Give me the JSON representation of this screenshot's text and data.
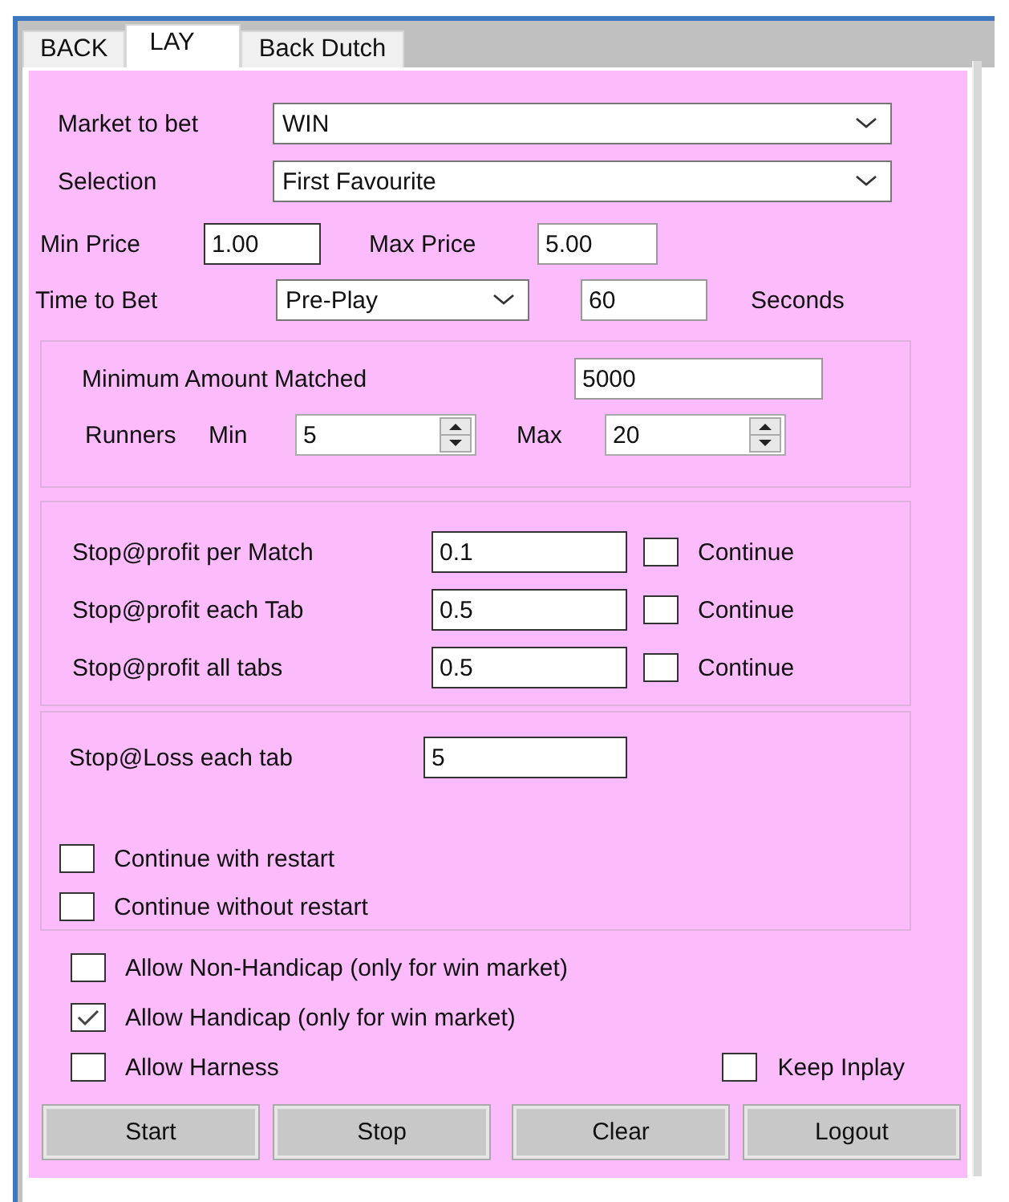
{
  "tabs": [
    {
      "label": "BACK",
      "selected": false
    },
    {
      "label": "LAY",
      "selected": true
    },
    {
      "label": "Back Dutch",
      "selected": false
    }
  ],
  "market": {
    "label": "Market to bet",
    "value": "WIN"
  },
  "selection": {
    "label": "Selection",
    "value": "First Favourite"
  },
  "min_price": {
    "label": "Min Price",
    "value": "1.00"
  },
  "max_price": {
    "label": "Max Price",
    "value": "5.00"
  },
  "time_to_bet": {
    "label": "Time to Bet",
    "value": "Pre-Play",
    "seconds_value": "60",
    "seconds_label": "Seconds"
  },
  "minimum_amount_matched": {
    "label": "Minimum Amount Matched",
    "value": "5000"
  },
  "runners": {
    "label": "Runners",
    "min_label": "Min",
    "min_value": "5",
    "max_label": "Max",
    "max_value": "20"
  },
  "stop_profit": [
    {
      "label": "Stop@profit per Match",
      "value": "0.1",
      "checkbox_label": "Continue",
      "checked": false
    },
    {
      "label": "Stop@profit each Tab",
      "value": "0.5",
      "checkbox_label": "Continue",
      "checked": false
    },
    {
      "label": "Stop@profit all tabs",
      "value": "0.5",
      "checkbox_label": "Continue",
      "checked": false
    }
  ],
  "stop_loss": {
    "label": "Stop@Loss each tab",
    "value": "5"
  },
  "restart_options": [
    {
      "label": "Continue with restart",
      "checked": false
    },
    {
      "label": "Continue without restart",
      "checked": false
    }
  ],
  "allow_options": [
    {
      "label": "Allow Non-Handicap (only for win market)",
      "checked": false
    },
    {
      "label": "Allow Handicap (only for win market)",
      "checked": true
    },
    {
      "label": "Allow Harness",
      "checked": false
    }
  ],
  "keep_inplay": {
    "label": "Keep Inplay",
    "checked": false
  },
  "buttons": [
    "Start",
    "Stop",
    "Clear",
    "Logout"
  ]
}
